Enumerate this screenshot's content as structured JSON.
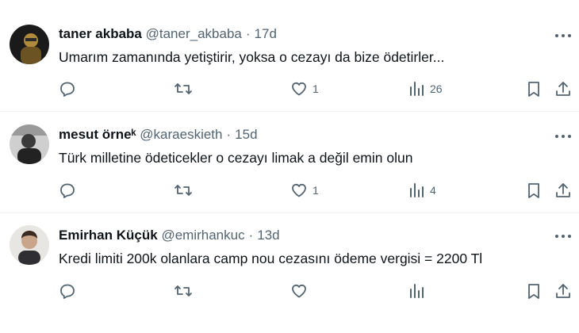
{
  "tweets": [
    {
      "name": "taner akbaba",
      "handle": "@taner_akbaba",
      "separator": "·",
      "time": "17d",
      "text": "Umarım zamanında yetiştirir, yoksa o cezayı da bize ödetirler...",
      "likes": "1",
      "views": "26",
      "avatar_icon": "avatar-dark-photo"
    },
    {
      "name": "mesut örneᵏ",
      "handle": "@karaeskieth",
      "separator": "·",
      "time": "15d",
      "text": "Türk milletine ödeticekler o cezayı limak a değil emin olun",
      "likes": "1",
      "views": "4",
      "avatar_icon": "avatar-grayscale-photo"
    },
    {
      "name": "Emirhan Küçük",
      "handle": "@emirhankuc",
      "separator": "·",
      "time": "13d",
      "text": "Kredi limiti 200k olanlara camp nou cezasını ödeme vergisi = 2200 Tl",
      "likes": "",
      "views": "",
      "avatar_icon": "avatar-person-photo"
    }
  ],
  "icons": {
    "reply": "reply-icon",
    "retweet": "retweet-icon",
    "like": "heart-icon",
    "views": "views-icon",
    "bookmark": "bookmark-icon",
    "share": "share-icon",
    "more": "more-icon"
  },
  "colors": {
    "text": "#0f1419",
    "secondary": "#536471",
    "divider": "#eff3f4"
  }
}
